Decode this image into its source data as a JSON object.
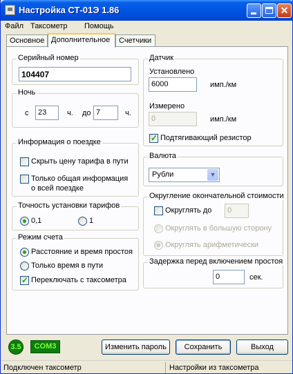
{
  "window": {
    "title": "Настройка СТ-01Э 1.86"
  },
  "menu": [
    "Файл",
    "Таксометр",
    "Помощь"
  ],
  "tabs": [
    "Основное",
    "Дополнительное",
    "Счетчики"
  ],
  "serial": {
    "label": "Серийный номер",
    "value": "104407"
  },
  "night": {
    "label": "Ночь",
    "from_label": "с",
    "from_value": "23",
    "unit1": "ч.",
    "to_label": "до",
    "to_value": "7",
    "unit2": "ч."
  },
  "trip_info": {
    "label": "Информация о поездке",
    "hide_fare": {
      "label": "Скрыть цену тарифа в пути",
      "checked": false
    },
    "total_only": {
      "label_line1": "Только общая информация",
      "label_line2": "о всей поездке",
      "checked": false
    }
  },
  "precision": {
    "label": "Точность установки тарифов",
    "opt1": "0,1",
    "opt2": "1",
    "selected": "0,1"
  },
  "count_mode": {
    "label": "Режим счета",
    "opt1": "Расстояние и время простоя",
    "opt2": "Только время в пути",
    "selected": "Расстояние и время простоя",
    "switch_label": "Переключать с таксометра",
    "switch_checked": true
  },
  "sensor": {
    "label": "Датчик",
    "set_label": "Установлено",
    "set_value": "6000",
    "set_unit": "имп./км",
    "measured_label": "Измерено",
    "measured_value": "0",
    "measured_unit": "имп./км",
    "pullup_label": "Подтягивающий резистор",
    "pullup_checked": true
  },
  "currency": {
    "label": "Валюта",
    "value": "Рубли"
  },
  "rounding": {
    "label": "Округление  окончательной стоимости",
    "round_to_label": "Округлять до",
    "round_to_value": "0",
    "round_checked": false,
    "up_label": "Округлять в большую сторону",
    "arith_label": "Округлять арифметически",
    "selected": "arith"
  },
  "idle_delay": {
    "label": "Задержка перед включением простоя",
    "value": "0",
    "unit": "сек."
  },
  "footer": {
    "version_badge": "3.5",
    "port_badge": "COM3",
    "change_password": "Изменить пароль",
    "save": "Сохранить",
    "exit": "Выход"
  },
  "status": {
    "left": "Подключен таксометр",
    "right": "Настройки из таксометра"
  },
  "colors": {
    "titlebar": "#0055E5",
    "face": "#ECE9D8",
    "panel": "#FCFCFE",
    "badge_bg": "#0E7C0E",
    "badge_text": "#7CFF3A",
    "check_green": "#21A121"
  }
}
